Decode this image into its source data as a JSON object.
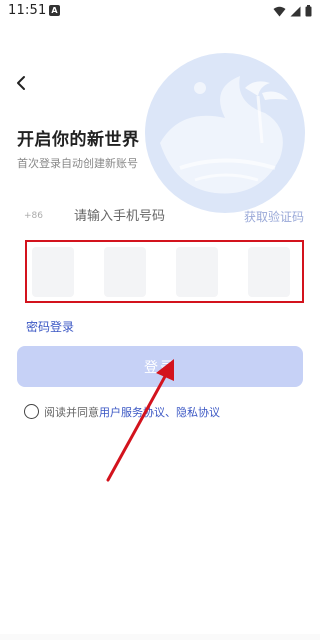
{
  "status_bar": {
    "time": "11:51",
    "notif_glyph": "A",
    "icons": [
      "wifi-icon",
      "signal-icon",
      "battery-icon"
    ]
  },
  "login": {
    "title": "开启你的新世界",
    "subtitle": "首次登录自动创建新账号",
    "country_code": "+86",
    "phone_placeholder": "请输入手机号码",
    "phone_value": "",
    "get_code_label": "获取验证码",
    "code_digits": [
      "",
      "",
      "",
      ""
    ],
    "password_login_label": "密码登录",
    "login_button_label": "登录",
    "agreement": {
      "prefix": "阅读并同意",
      "user_agreement": "用户服务协议",
      "separator": "、",
      "privacy_policy": "隐私协议",
      "checked": false
    }
  },
  "colors": {
    "accent": "#3b57c4",
    "button_disabled": "#c6d1f6",
    "get_code": "#9aa9d8",
    "highlight": "#d3131d",
    "watermark": "#dce6f8"
  },
  "annotations": {
    "highlight_frame": "red-rectangle",
    "arrow": "red-arrow-icon"
  }
}
